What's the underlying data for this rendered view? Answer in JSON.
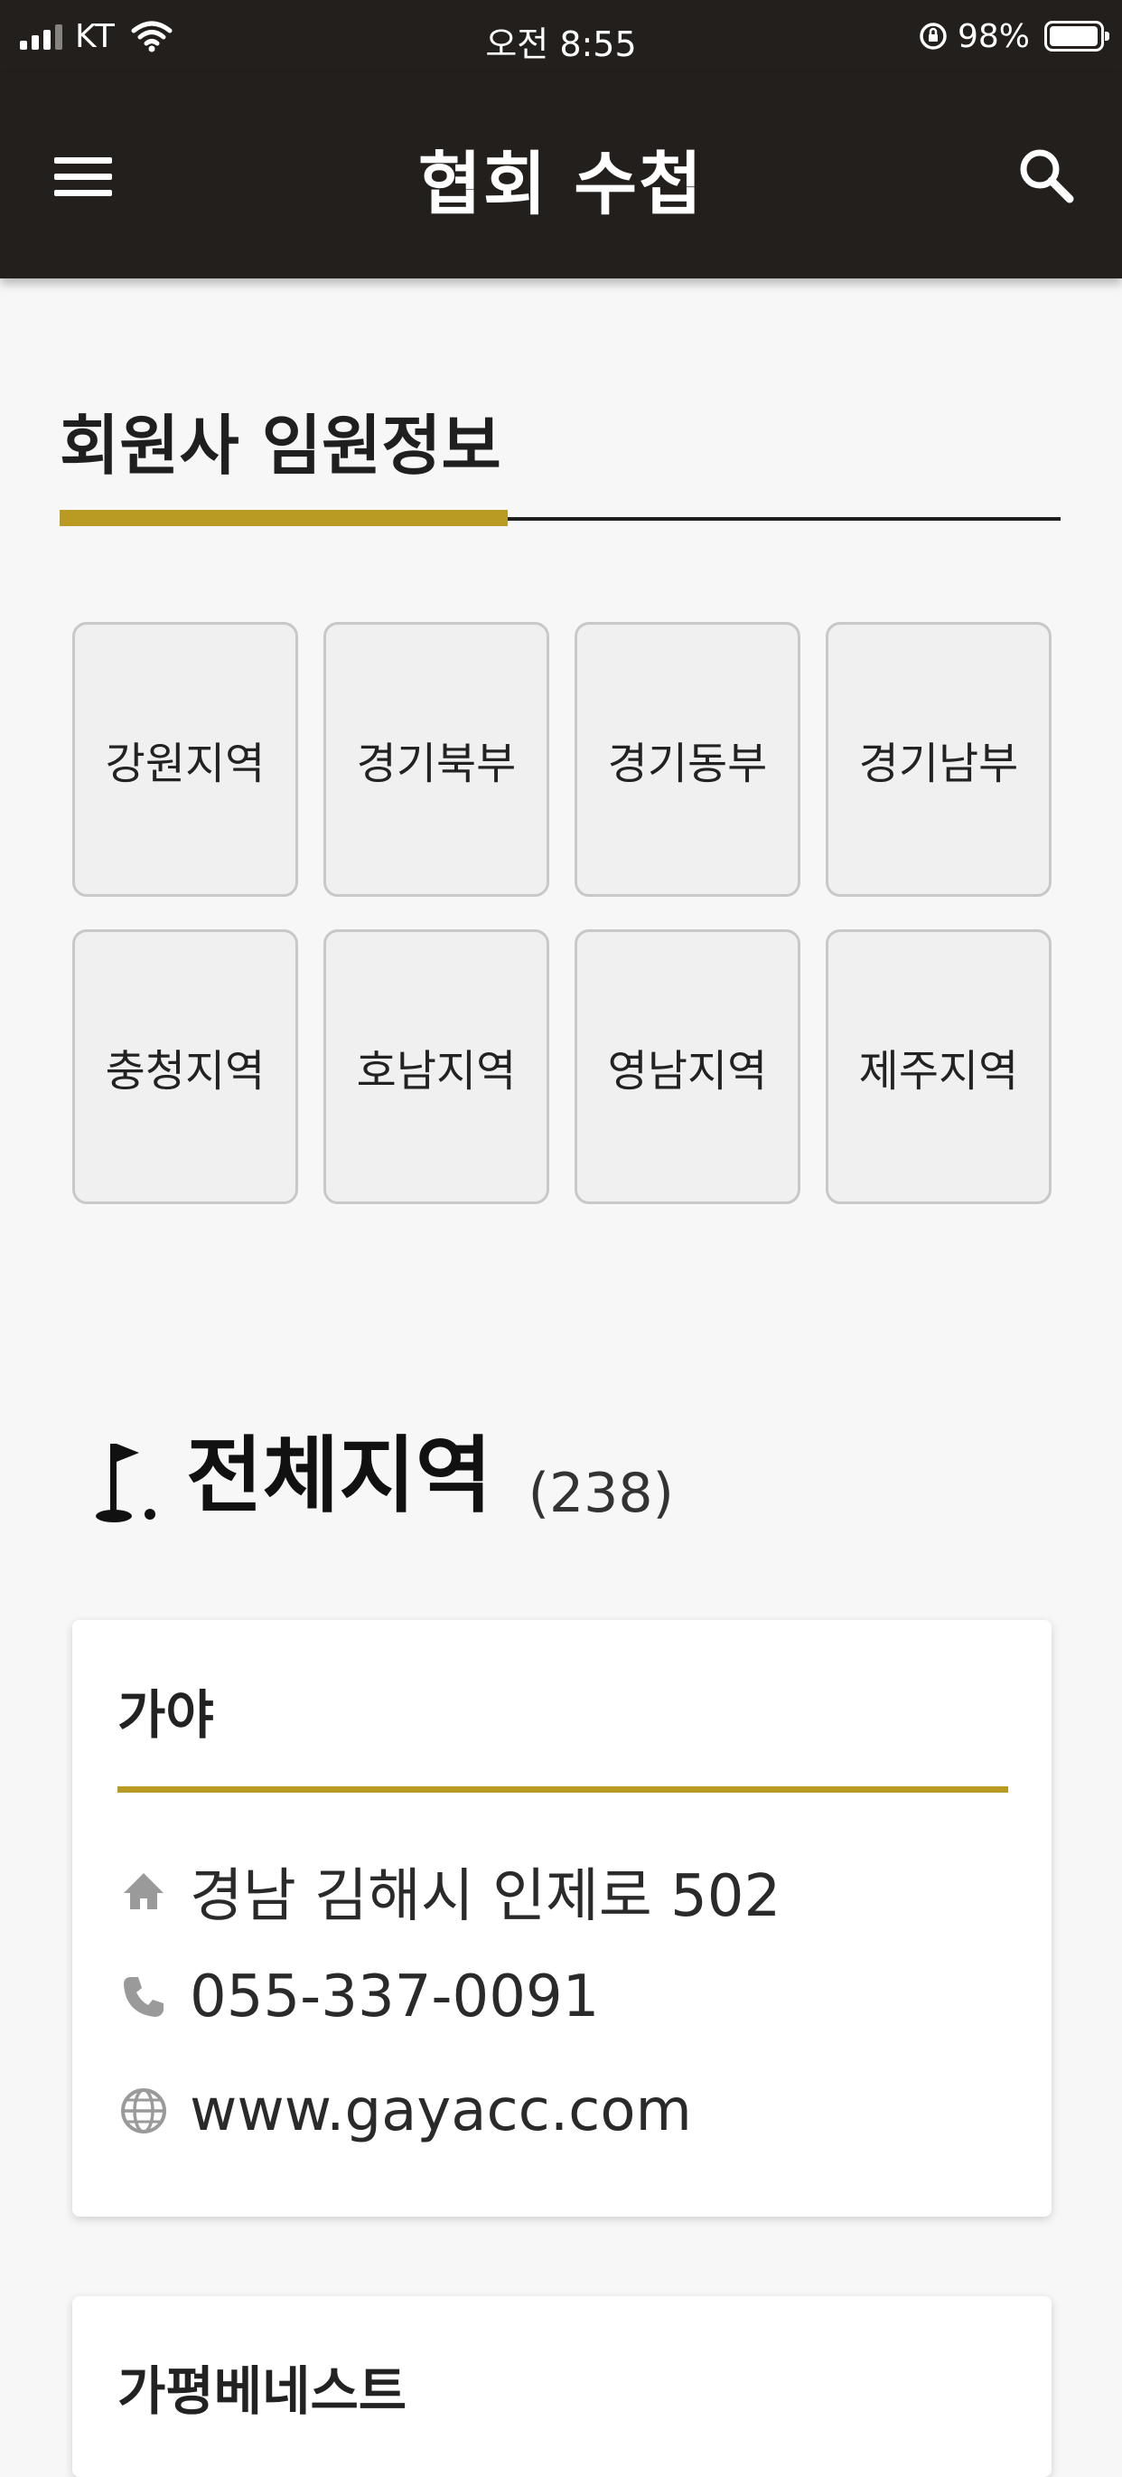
{
  "status_bar": {
    "carrier": "KT",
    "time": "오전 8:55",
    "battery_percent": "98%",
    "battery_level": 0.98
  },
  "header": {
    "title": "협회 수첩",
    "menu_icon": "hamburger-menu-icon",
    "search_icon": "search-icon"
  },
  "section": {
    "title": "회원사 임원정보"
  },
  "regions": [
    {
      "label": "강원지역"
    },
    {
      "label": "경기북부"
    },
    {
      "label": "경기동부"
    },
    {
      "label": "경기남부"
    },
    {
      "label": "충청지역"
    },
    {
      "label": "호남지역"
    },
    {
      "label": "영남지역"
    },
    {
      "label": "제주지역"
    }
  ],
  "selected_region": {
    "name": "전체지역",
    "count": "(238)",
    "icon": "golf-flag-icon"
  },
  "clubs": [
    {
      "name": "가야",
      "address": "경남 김해시 인제로 502",
      "phone": "055-337-0091",
      "website": "www.gayacc.com"
    },
    {
      "name": "가평베네스트"
    }
  ],
  "colors": {
    "header_bg": "#231f1c",
    "accent_gold": "#b99a22",
    "page_bg": "#f7f7f7",
    "icon_gray": "#9a9a9a"
  }
}
